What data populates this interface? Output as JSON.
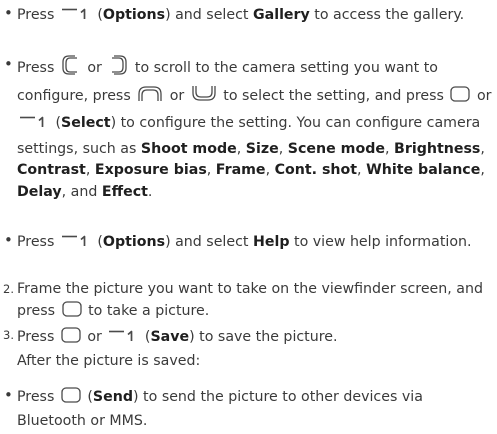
{
  "items": [
    {
      "marker": "•",
      "parts": [
        {
          "t": "Press "
        },
        {
          "icon": "softkey-left-icon"
        },
        {
          "t": " ("
        },
        {
          "b": "Options"
        },
        {
          "t": ") and select "
        },
        {
          "b": "Gallery"
        },
        {
          "t": " to access the gallery."
        }
      ]
    },
    {
      "marker": "•",
      "parts": [
        {
          "t": "Press "
        },
        {
          "icon": "nav-left-key-icon"
        },
        {
          "t": " or "
        },
        {
          "icon": "nav-right-key-icon"
        },
        {
          "t": " to scroll to the camera setting you want to configure, press "
        },
        {
          "icon": "nav-up-key-icon"
        },
        {
          "t": " or "
        },
        {
          "icon": "nav-down-key-icon"
        },
        {
          "t": " to select the setting, and press "
        },
        {
          "icon": "center-key-icon"
        },
        {
          "t": " or "
        },
        {
          "icon": "softkey-left-icon"
        },
        {
          "t": " ("
        },
        {
          "b": "Select"
        },
        {
          "t": ") to configure the setting. You can configure camera settings, such as "
        },
        {
          "b": "Shoot mode"
        },
        {
          "t": ", "
        },
        {
          "b": "Size"
        },
        {
          "t": ", "
        },
        {
          "b": "Scene mode"
        },
        {
          "t": ", "
        },
        {
          "b": "Brightness"
        },
        {
          "t": ", "
        },
        {
          "b": "Contrast"
        },
        {
          "t": ", "
        },
        {
          "b": "Exposure bias"
        },
        {
          "t": ", "
        },
        {
          "b": "Frame"
        },
        {
          "t": ", "
        },
        {
          "b": "Cont. shot"
        },
        {
          "t": ", "
        },
        {
          "b": "White balance"
        },
        {
          "t": ", "
        },
        {
          "b": "Delay"
        },
        {
          "t": ", and "
        },
        {
          "b": "Effect"
        },
        {
          "t": "."
        }
      ]
    },
    {
      "marker": "•",
      "parts": [
        {
          "t": "Press "
        },
        {
          "icon": "softkey-left-icon"
        },
        {
          "t": " ("
        },
        {
          "b": "Options"
        },
        {
          "t": ") and select "
        },
        {
          "b": "Help"
        },
        {
          "t": " to view help information."
        }
      ]
    },
    {
      "marker": "2.",
      "parts": [
        {
          "t": "Frame the picture you want to take on the viewfinder screen, and press "
        },
        {
          "icon": "center-key-icon"
        },
        {
          "t": " to take a picture."
        }
      ]
    },
    {
      "marker": "3.",
      "parts": [
        {
          "t": "Press "
        },
        {
          "icon": "center-key-icon"
        },
        {
          "t": " or "
        },
        {
          "icon": "softkey-left-icon"
        },
        {
          "t": " ("
        },
        {
          "b": "Save"
        },
        {
          "t": ") to save the picture."
        },
        {
          "br": true
        },
        {
          "t": "After the picture is saved:"
        }
      ]
    },
    {
      "marker": "•",
      "parts": [
        {
          "t": "Press "
        },
        {
          "icon": "center-key-icon"
        },
        {
          "t": " ("
        },
        {
          "b": "Send"
        },
        {
          "t": ") to send the picture to other devices via Bluetooth or MMS."
        }
      ]
    }
  ]
}
